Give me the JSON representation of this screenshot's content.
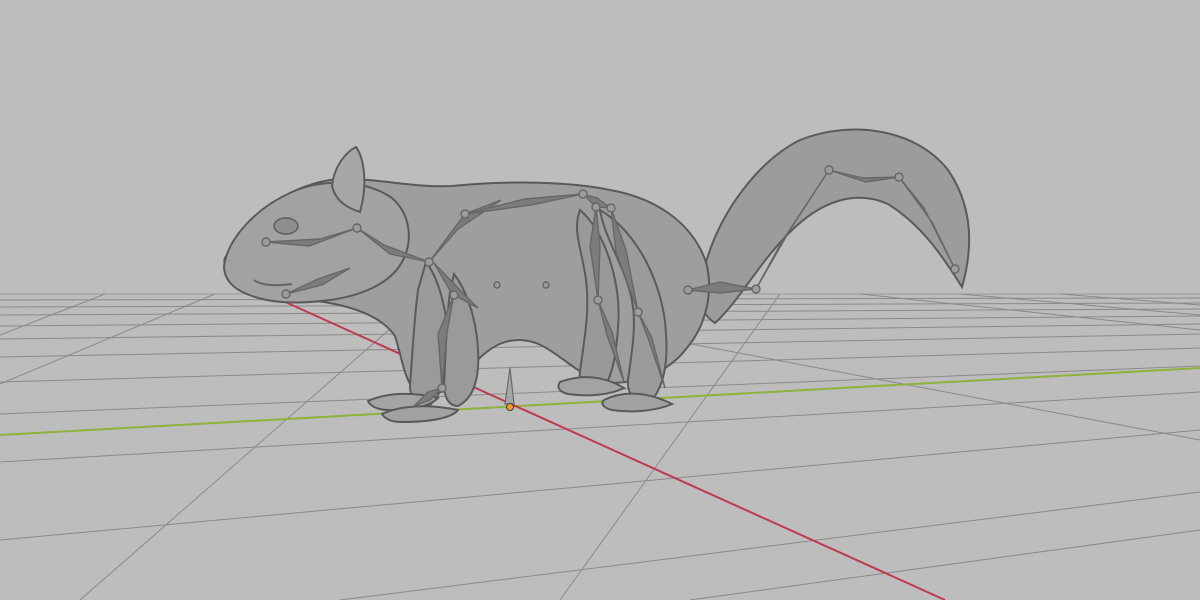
{
  "viewport": {
    "background_color": "#bdbdbd",
    "grid_color": "#8a8a8a",
    "x_axis_color": "#c0394f",
    "y_axis_color": "#8fb23b",
    "mesh_color": "#9b9b9b",
    "bone_color": "#6e6e6e",
    "origin_marker_color": "#f39b1d"
  },
  "scene": {
    "object": "squirrel",
    "shading": "solid",
    "armature_visible": true,
    "floor_grid_visible": true
  }
}
